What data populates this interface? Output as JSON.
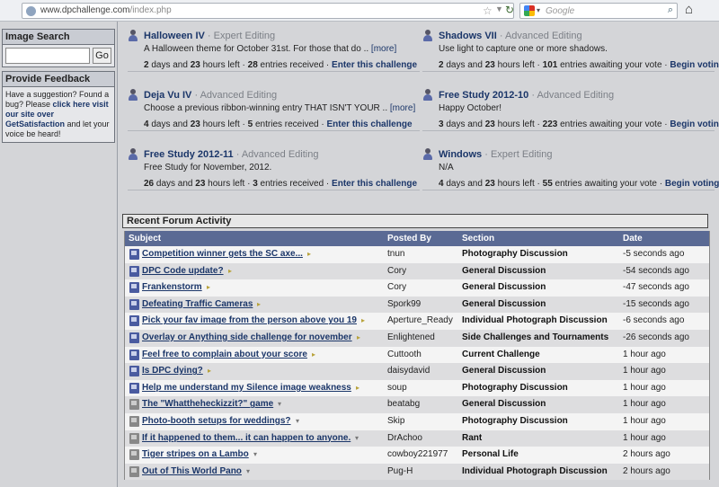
{
  "browser": {
    "url_host": "www.dpchallenge.com",
    "url_path": "/index.php",
    "search_placeholder": "Google"
  },
  "sidebar": {
    "image_search": {
      "title": "Image Search",
      "go_label": "Go"
    },
    "feedback": {
      "title": "Provide Feedback",
      "text_1": "Have a suggestion? Found a bug? Please ",
      "link": "click here visit our site over GetSatisfaction",
      "text_2": " and let your voice be heard!"
    }
  },
  "challenges": [
    {
      "name": "Halloween IV",
      "kind": "Expert Editing",
      "desc": "A Halloween theme for October 31st. For those that do ..",
      "more": "[more]",
      "days": "2",
      "hours": "23",
      "time_mid": " days and ",
      "time_end": " hours left · ",
      "count": "28",
      "count_text": " entries received · ",
      "action": "Enter this challenge"
    },
    {
      "name": "Shadows VII",
      "kind": "Advanced Editing",
      "desc": "Use light to capture one or more shadows.",
      "more": "",
      "days": "2",
      "hours": "23",
      "time_mid": " days and ",
      "time_end": " hours left · ",
      "count": "101",
      "count_text": " entries awaiting your vote · ",
      "action": "Begin voting"
    },
    {
      "name": "Deja Vu IV",
      "kind": "Advanced Editing",
      "desc": "Choose a previous ribbon-winning entry THAT ISN'T YOUR ..",
      "more": "[more]",
      "days": "4",
      "hours": "23",
      "time_mid": " days and ",
      "time_end": " hours left · ",
      "count": "5",
      "count_text": " entries received · ",
      "action": "Enter this challenge"
    },
    {
      "name": "Free Study 2012-10",
      "kind": "Advanced Editing",
      "desc": "Happy October!",
      "more": "",
      "days": "3",
      "hours": "23",
      "time_mid": " days and ",
      "time_end": " hours left · ",
      "count": "223",
      "count_text": " entries awaiting your vote · ",
      "action": "Begin voting"
    },
    {
      "name": "Free Study 2012-11",
      "kind": "Advanced Editing",
      "desc": "Free Study for November, 2012.",
      "more": "",
      "days": "26",
      "hours": "23",
      "time_mid": " days and ",
      "time_end": " hours left · ",
      "count": "3",
      "count_text": " entries received · ",
      "action": "Enter this challenge"
    },
    {
      "name": "Windows",
      "kind": "Expert Editing",
      "desc": "N/A",
      "more": "",
      "days": "4",
      "hours": "23",
      "time_mid": " days and ",
      "time_end": " hours left · ",
      "count": "55",
      "count_text": " entries awaiting your vote · ",
      "action": "Begin voting"
    }
  ],
  "forum": {
    "title": "Recent Forum Activity",
    "headers": {
      "subject": "Subject",
      "posted_by": "Posted By",
      "section": "Section",
      "date": "Date"
    },
    "rows": [
      {
        "subject": "Competition winner gets the SC axe...",
        "posted_by": "tnun",
        "section": "Photography Discussion",
        "date": "-5 seconds ago",
        "read": false
      },
      {
        "subject": "DPC Code update?",
        "posted_by": "Cory",
        "section": "General Discussion",
        "date": "-54 seconds ago",
        "read": false
      },
      {
        "subject": "Frankenstorm",
        "posted_by": "Cory",
        "section": "General Discussion",
        "date": "-47 seconds ago",
        "read": false
      },
      {
        "subject": "Defeating Traffic Cameras",
        "posted_by": "Spork99",
        "section": "General Discussion",
        "date": "-15 seconds ago",
        "read": false
      },
      {
        "subject": "Pick your fav image from the person above you 19",
        "posted_by": "Aperture_Ready",
        "section": "Individual Photograph Discussion",
        "date": "-6 seconds ago",
        "read": false
      },
      {
        "subject": "Overlay or Anything side challenge for november",
        "posted_by": "Enlightened",
        "section": "Side Challenges and Tournaments",
        "date": "-26 seconds ago",
        "read": false
      },
      {
        "subject": "Feel free to complain about your score",
        "posted_by": "Cuttooth",
        "section": "Current Challenge",
        "date": "1 hour ago",
        "read": false
      },
      {
        "subject": "Is DPC dying?",
        "posted_by": "daisydavid",
        "section": "General Discussion",
        "date": "1 hour ago",
        "read": false
      },
      {
        "subject": "Help me understand my Silence image weakness",
        "posted_by": "soup",
        "section": "Photography Discussion",
        "date": "1 hour ago",
        "read": false
      },
      {
        "subject": "The \"Whattheheckizzit?\" game",
        "posted_by": "beatabg",
        "section": "General Discussion",
        "date": "1 hour ago",
        "read": true
      },
      {
        "subject": "Photo-booth setups for weddings?",
        "posted_by": "Skip",
        "section": "Photography Discussion",
        "date": "1 hour ago",
        "read": true
      },
      {
        "subject": "If it happened to them... it can happen to anyone.",
        "posted_by": "DrAchoo",
        "section": "Rant",
        "date": "1 hour ago",
        "read": true
      },
      {
        "subject": "Tiger stripes on a Lambo",
        "posted_by": "cowboy221977",
        "section": "Personal Life",
        "date": "2 hours ago",
        "read": true
      },
      {
        "subject": "Out of This World Pano",
        "posted_by": "Pug-H",
        "section": "Individual Photograph Discussion",
        "date": "2 hours ago",
        "read": true
      }
    ]
  }
}
